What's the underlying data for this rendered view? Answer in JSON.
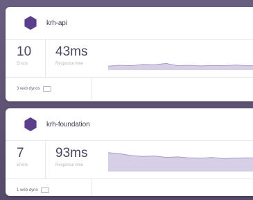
{
  "apps": [
    {
      "name": "krh-api",
      "errors": {
        "value": "10",
        "label": "Errors"
      },
      "response": {
        "value": "43ms",
        "label": "Response time"
      },
      "dynos": "3 web dynos",
      "sparkline": [
        0.18,
        0.22,
        0.2,
        0.26,
        0.24,
        0.3,
        0.2,
        0.22,
        0.19,
        0.21,
        0.2,
        0.23,
        0.2,
        0.2
      ]
    },
    {
      "name": "krh-foundation",
      "errors": {
        "value": "7",
        "label": "Errors"
      },
      "response": {
        "value": "93ms",
        "label": "Response time"
      },
      "dynos": "1 web dyno",
      "sparkline": [
        0.85,
        0.8,
        0.72,
        0.68,
        0.7,
        0.64,
        0.66,
        0.62,
        0.6,
        0.63,
        0.58,
        0.6,
        0.62,
        0.6
      ]
    }
  ],
  "colors": {
    "accent": "#5a3f8f",
    "sparkline_fill": "#d6cfe6",
    "sparkline_stroke": "#a89bc6"
  }
}
